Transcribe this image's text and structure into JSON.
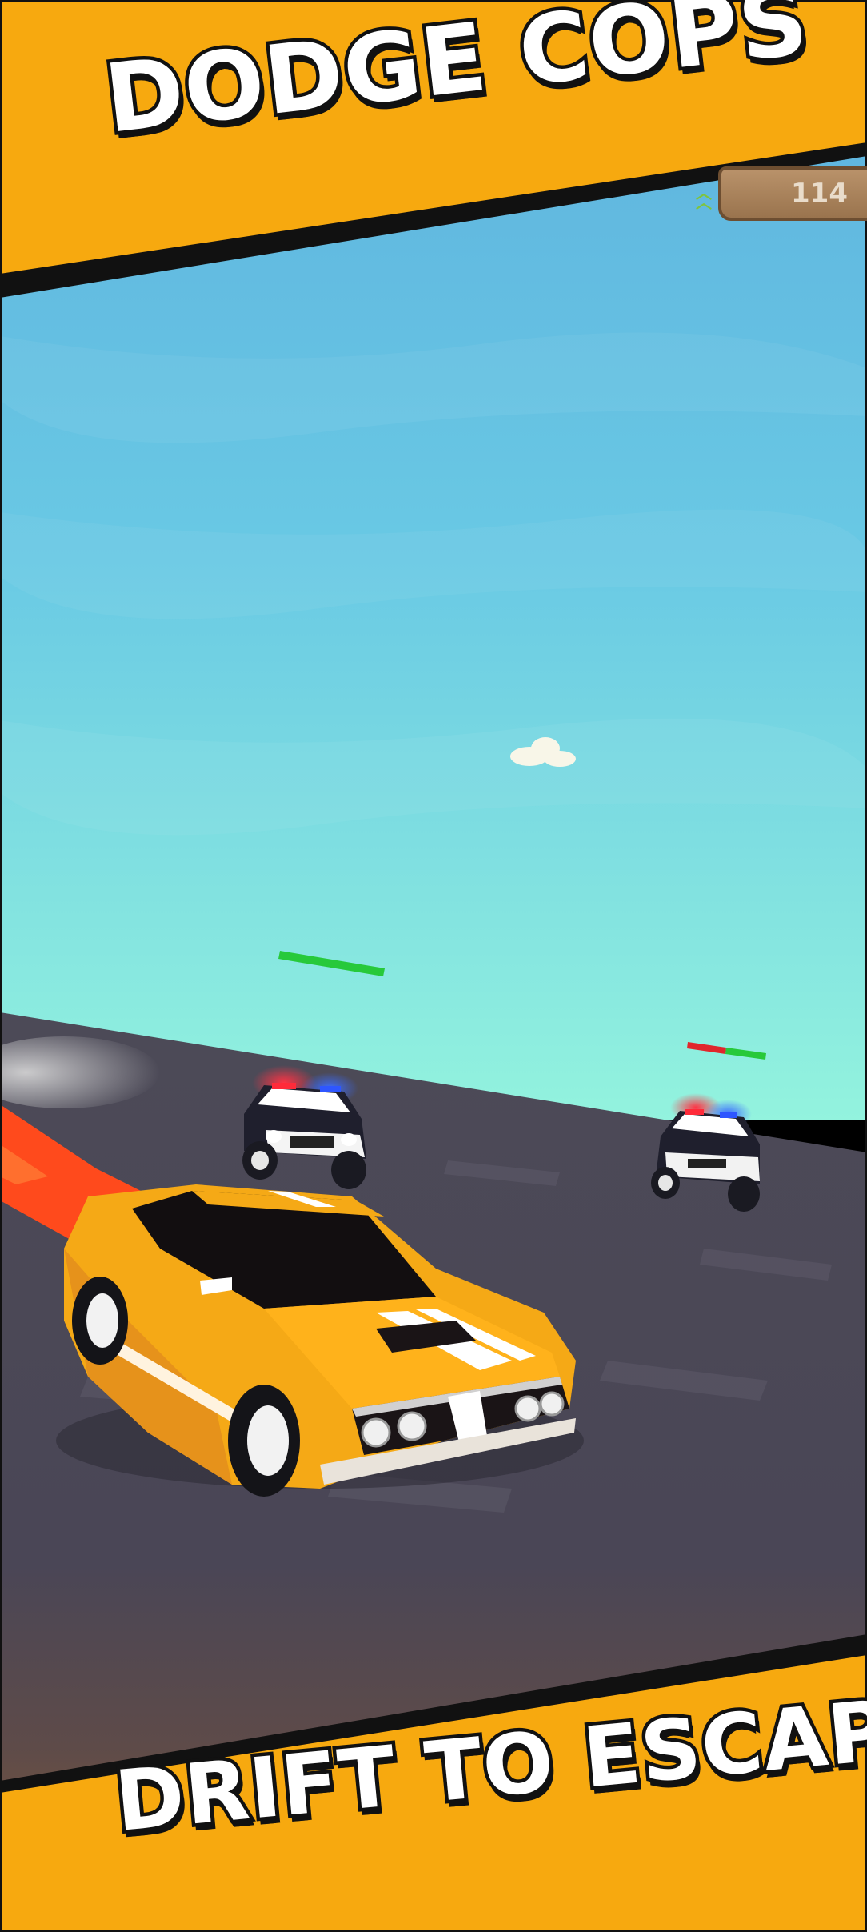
{
  "banners": {
    "top_title": "DODGE COPS",
    "bottom_title": "DRIFT TO ESCAPE"
  },
  "hud": {
    "score": "114",
    "score_icon": "chevron-up-arrows-icon"
  },
  "colors": {
    "banner_orange": "#f7a90f",
    "sky_top": "#5fb7e0",
    "sky_bottom": "#8ff2e0",
    "road": "#4a4856",
    "player_car": "#f5a916",
    "health_green": "#27c93a",
    "health_red": "#e0262c"
  },
  "enemies": [
    {
      "name": "police-car-left",
      "health": 1.0
    },
    {
      "name": "police-car-right",
      "health": 0.45
    }
  ]
}
